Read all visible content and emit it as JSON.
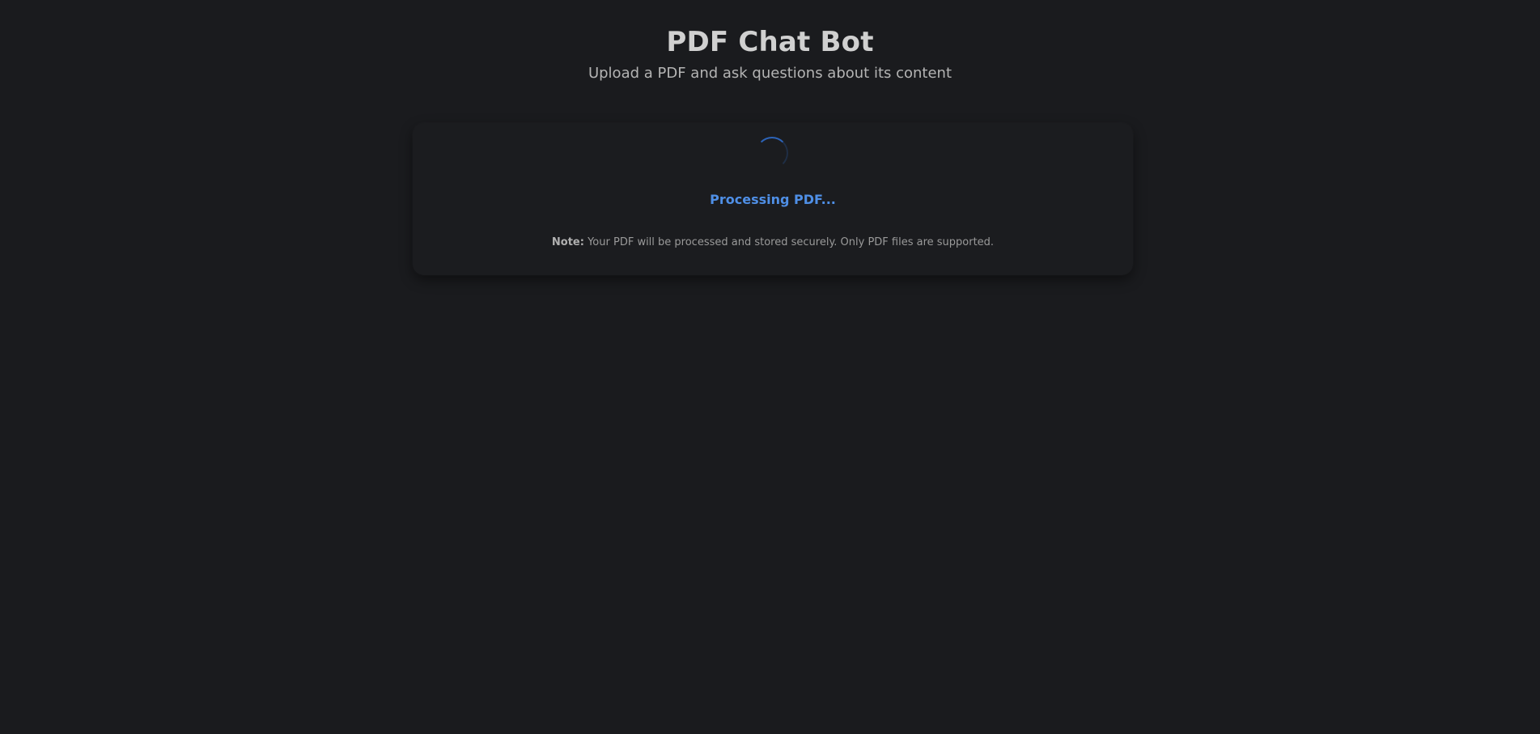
{
  "header": {
    "title": "PDF Chat Bot",
    "subtitle": "Upload a PDF and ask questions about its content"
  },
  "processing": {
    "spinner_icon": "loading-spinner-icon",
    "status_text": "Processing PDF...",
    "note_label": "Note:",
    "note_text": "Your PDF will be processed and stored securely. Only PDF files are supported."
  },
  "colors": {
    "background": "#1a1b1e",
    "accent": "#4f8fe6"
  }
}
